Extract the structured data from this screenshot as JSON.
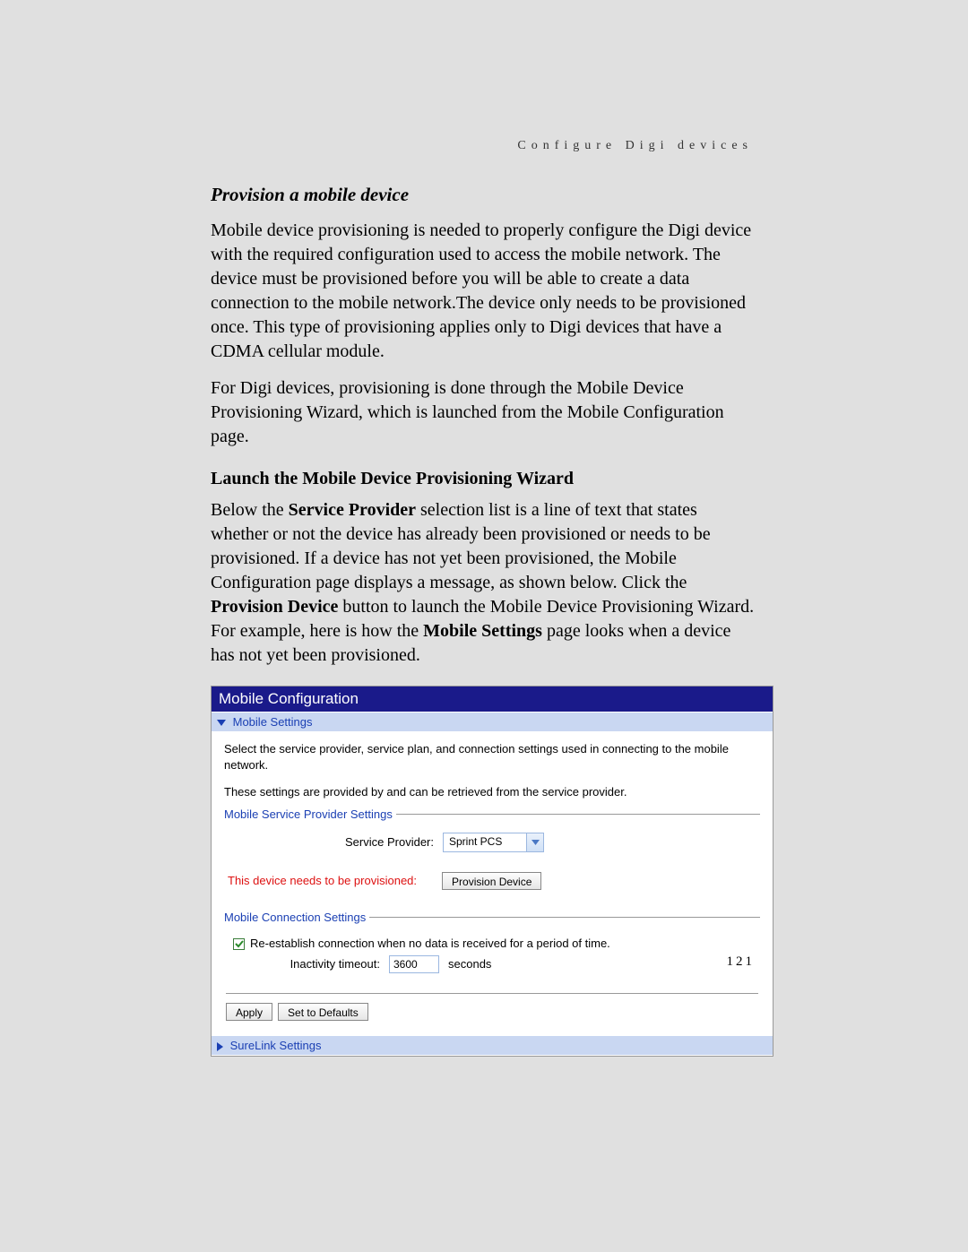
{
  "running_header": "Configure Digi devices",
  "page_number": "121",
  "section": {
    "title": "Provision a mobile device",
    "para1": "Mobile device provisioning is needed to properly configure the Digi device with the required configuration used to access the mobile network. The device must be provisioned before you will be able to create a data connection to the mobile network.The device only needs to be provisioned once. This type of provisioning applies only to Digi devices that have a CDMA cellular module.",
    "para2": "For Digi devices, provisioning is done through the Mobile Device Provisioning Wizard, which is launched from the Mobile Configuration page."
  },
  "subsection": {
    "heading": "Launch the Mobile Device Provisioning Wizard",
    "para_pre": "Below the ",
    "bold1": "Service Provider",
    "para_mid1": " selection list is a line of text that states whether or not the device has already been provisioned or needs to be provisioned. If a device has not yet been provisioned, the Mobile Configuration page displays a message, as shown below. Click the ",
    "bold2": "Provision Device",
    "para_mid2": " button to launch the Mobile Device Provisioning Wizard. For example, here is how the ",
    "bold3": "Mobile Settings",
    "para_post": " page looks when a device has not yet been provisioned."
  },
  "ui": {
    "title": "Mobile Configuration",
    "mobile_settings_label": "Mobile Settings",
    "intro1": "Select the service provider, service plan, and connection settings used in connecting to the mobile network.",
    "intro2": "These settings are provided by and can be retrieved from the service provider.",
    "provider_fieldset": "Mobile Service Provider Settings",
    "service_provider_label": "Service Provider:",
    "service_provider_value": "Sprint PCS",
    "provision_warning": "This device needs to be provisioned:",
    "provision_button": "Provision Device",
    "conn_fieldset": "Mobile Connection Settings",
    "reestablish_label": "Re-establish connection when no data is received for a period of time.",
    "inactivity_label": "Inactivity timeout:",
    "inactivity_value": "3600",
    "seconds_label": "seconds",
    "apply_button": "Apply",
    "defaults_button": "Set to Defaults",
    "surelink_label": "SureLink Settings"
  }
}
